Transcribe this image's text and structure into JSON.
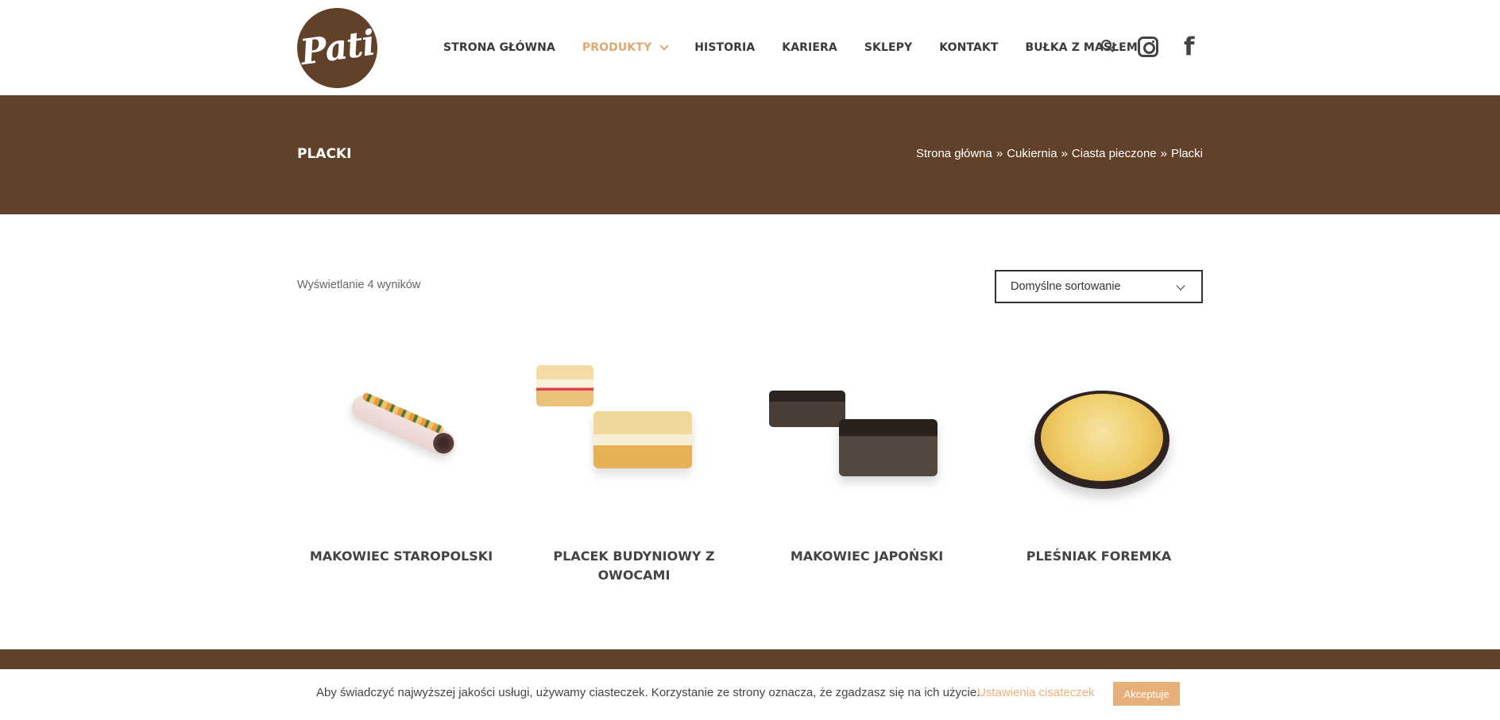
{
  "header": {
    "logo_text": "Pati",
    "nav": [
      {
        "label": "STRONA GŁÓWNA",
        "active": false
      },
      {
        "label": "PRODUKTY",
        "active": true,
        "has_dropdown": true
      },
      {
        "label": "HISTORIA",
        "active": false
      },
      {
        "label": "KARIERA",
        "active": false
      },
      {
        "label": "SKLEPY",
        "active": false
      },
      {
        "label": "KONTAKT",
        "active": false
      },
      {
        "label": "BUŁKA Z MASŁEM",
        "active": false
      }
    ],
    "icons": [
      "search-icon",
      "instagram-icon",
      "facebook-icon"
    ]
  },
  "title_bar": {
    "title": "PLACKI",
    "breadcrumb": [
      "Strona główna",
      "Cukiernia",
      "Ciasta pieczone",
      "Placki"
    ],
    "separator": "»"
  },
  "toolbar": {
    "result_count": "Wyświetlanie 4 wyników",
    "sort_value": "Domyślne sortowanie"
  },
  "products": [
    {
      "name": "MAKOWIEC STAROPOLSKI"
    },
    {
      "name": "PLACEK BUDYNIOWY Z OWOCAMI"
    },
    {
      "name": "MAKOWIEC JAPOŃSKI"
    },
    {
      "name": "PLEŚNIAK FOREMKA"
    }
  ],
  "cookie_bar": {
    "text": "Aby świadczyć najwyższej jakości usługi, używamy ciasteczek. Korzystanie ze strony oznacza, że zgadzasz się na ich użycie.",
    "settings_label": "Ustawienia cisateczek",
    "accept_label": "Akceptuje"
  },
  "colors": {
    "brand_brown": "#62412a",
    "accent_orange": "#e2a76f",
    "text_dark": "#3a3a3a"
  }
}
